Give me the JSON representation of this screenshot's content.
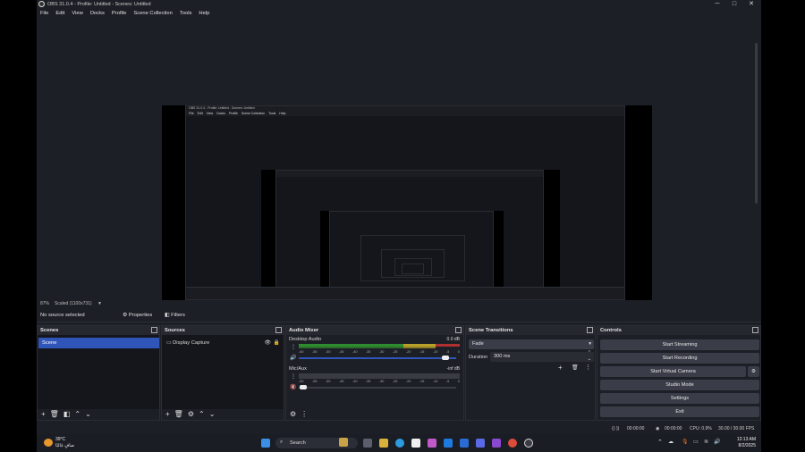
{
  "window": {
    "title": "OBS 31.0.4 - Profile: Untitled - Scenes: Untitled",
    "minimize": "─",
    "maximize": "□",
    "close": "✕"
  },
  "menu": [
    "File",
    "Edit",
    "View",
    "Docks",
    "Profile",
    "Scene Collection",
    "Tools",
    "Help"
  ],
  "preview": {
    "zoom": "87%",
    "scaled": "Scaled (1100x731)",
    "nested_title": "OBS 31.0.4 - Profile: Untitled - Scenes: Untitled",
    "nested_menu": [
      "File",
      "Edit",
      "View",
      "Docks",
      "Profile",
      "Scene Collection",
      "Tools",
      "Help"
    ]
  },
  "source_bar": {
    "status": "No source selected",
    "properties": "Properties",
    "filters": "Filters"
  },
  "scenes": {
    "title": "Scenes",
    "items": [
      "Scene"
    ]
  },
  "sources": {
    "title": "Sources",
    "items": [
      "Display Capture"
    ]
  },
  "mixer": {
    "title": "Audio Mixer",
    "channels": [
      {
        "name": "Desktop Audio",
        "level": "0.0 dB",
        "volume": 0.93
      },
      {
        "name": "Mic/Aux",
        "level": "-inf dB",
        "volume": 0.03
      }
    ],
    "ticks": [
      "-60",
      "-55",
      "-50",
      "-45",
      "-40",
      "-35",
      "-30",
      "-25",
      "-20",
      "-15",
      "-10",
      "-5",
      "0"
    ]
  },
  "transitions": {
    "title": "Scene Transitions",
    "selected": "Fade",
    "duration_label": "Duration",
    "duration_value": "300 ms"
  },
  "controls": {
    "title": "Controls",
    "buttons": [
      "Start Streaming",
      "Start Recording",
      "Start Virtual Camera",
      "Studio Mode",
      "Settings",
      "Exit"
    ]
  },
  "status": {
    "stream_time": "00:00:00",
    "rec_time": "00:00:00",
    "cpu": "CPU: 0.9%",
    "fps": "30.00 / 30.00 FPS"
  },
  "taskbar": {
    "temperature": "39°C",
    "weather": "صافٍ غالبًا",
    "search": "Search",
    "time": "12:13 AM",
    "date": "8/2/2025"
  },
  "colors": {
    "accent": "#2f55b8",
    "meter_green": "#2e8b2e",
    "meter_yellow": "#b8a12a",
    "meter_red": "#b03030"
  }
}
